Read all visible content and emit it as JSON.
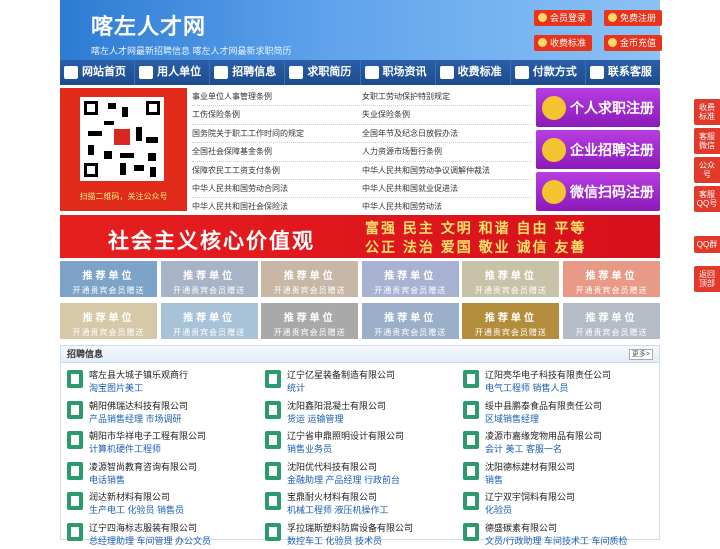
{
  "header": {
    "logo": "喀左人才网",
    "slogan": "喀左人才网最新招聘信息 喀左人才网最新求职简历",
    "buttons": [
      "会员登录",
      "免费注册",
      "收费标准",
      "金币充值"
    ]
  },
  "nav": [
    "网站首页",
    "用人单位",
    "招聘信息",
    "求职简历",
    "职场资讯",
    "收费标准",
    "付款方式",
    "联系客服"
  ],
  "qr": {
    "caption": "扫描二维码，关注公众号"
  },
  "links": [
    [
      "事业单位人事管理条例",
      "女职工劳动保护特别规定"
    ],
    [
      "工伤保险条例",
      "失业保险条例"
    ],
    [
      "国务院关于职工工作时间的规定",
      "全国年节及纪念日放假办法"
    ],
    [
      "全国社会保障基金条例",
      "人力资源市场暂行条例"
    ],
    [
      "保障农民工工资支付条例",
      "中华人民共和国劳动争议调解仲裁法"
    ],
    [
      "中华人民共和国劳动合同法",
      "中华人民共和国就业促进法"
    ],
    [
      "中华人民共和国社会保险法",
      "中华人民共和国劳动法"
    ]
  ],
  "register": [
    "个人求职注册",
    "企业招聘注册",
    "微信扫码注册"
  ],
  "banner": {
    "title": "社会主义核心价值观",
    "line1": "富强 民主 文明 和谐 自由 平等",
    "line2": "公正 法治 爱国 敬业 诚信 友善"
  },
  "tile": {
    "title": "推荐单位",
    "subtitle": "开通贵宾会员赠送"
  },
  "tile_colors": [
    "#7da3c8",
    "#a7b3c7",
    "#c7b7a4",
    "#a8b2d3",
    "#c8c3a8",
    "#e89a86",
    "#d7c9a8",
    "#a8c2d8",
    "#a9a9a9",
    "#9bb0c8",
    "#b48d3c",
    "#b6bcc6"
  ],
  "jobs": {
    "title": "招聘信息",
    "more": "更多>",
    "items": [
      {
        "company": "喀左县大城子镇乐观商行",
        "positions": "淘宝图片美工"
      },
      {
        "company": "辽宁亿星装备制造有限公司",
        "positions": "统计"
      },
      {
        "company": "辽阳亮华电子科技有限责任公司",
        "positions": "电气工程师 销售人员"
      },
      {
        "company": "朝阳佛瑞达科技有限公司",
        "positions": "产品销售经理 市场调研"
      },
      {
        "company": "沈阳鑫阳混凝土有限公司",
        "positions": "货运 运输管理"
      },
      {
        "company": "绥中县鹏泰食品有限责任公司",
        "positions": "区域销售经理"
      },
      {
        "company": "朝阳市华祥电子工程有限公司",
        "positions": "计算机硬件工程师"
      },
      {
        "company": "辽宁省申鼎照明设计有限公司",
        "positions": "销售业务员"
      },
      {
        "company": "凌源市嘉缘宠物用品有限公司",
        "positions": "会计 美工 客服一名"
      },
      {
        "company": "凌源智尚教育咨询有限公司",
        "positions": "电话销售"
      },
      {
        "company": "沈阳优代科技有限公司",
        "positions": "金融助理 产品经理 行政前台"
      },
      {
        "company": "沈阳德标建材有限公司",
        "positions": "销售"
      },
      {
        "company": "润达新材料有限公司",
        "positions": "生产电工 化验员 销售员"
      },
      {
        "company": "宝鼎耐火材料有限公司",
        "positions": "机械工程师 液压机操作工"
      },
      {
        "company": "辽宁双宇饲料有限公司",
        "positions": "化验员"
      },
      {
        "company": "辽宁四海标志服装有限公司",
        "positions": "总经理助理 车间管理 办公文员"
      },
      {
        "company": "孚拉瑞斯塑料防腐设备有限公司",
        "positions": "数控车工 化验员 技术员"
      },
      {
        "company": "德盛碳素有限公司",
        "positions": "文员/行政助理 车间技术工 车间质检"
      }
    ]
  },
  "side": [
    "收费标准",
    "客服微信",
    "公众号",
    "客服QQ号",
    "QQ群",
    "返回顶部"
  ]
}
